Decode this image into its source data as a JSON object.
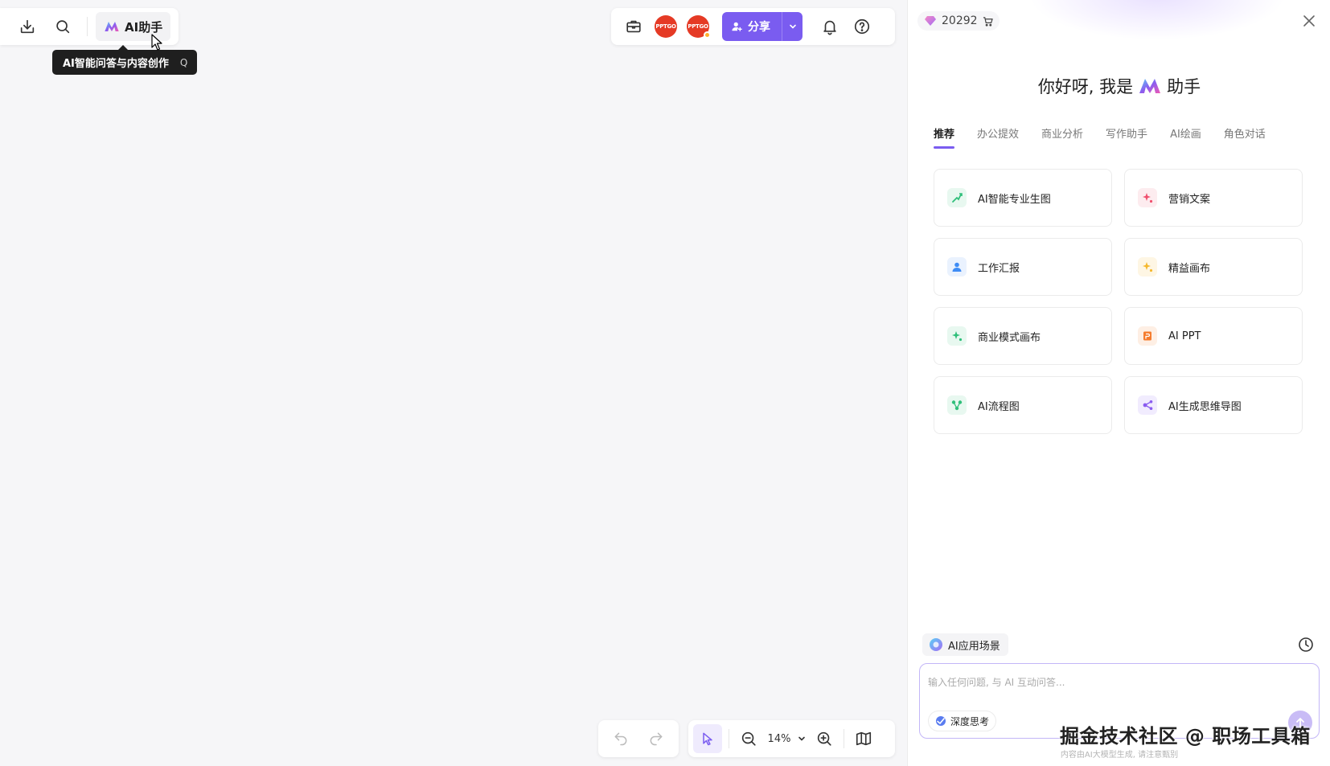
{
  "toolbar_left": {
    "ai_button_label": "AI助手",
    "tooltip_text": "AI智能问答与内容创作",
    "tooltip_shortcut": "Q"
  },
  "toolbar_right": {
    "avatar_text": "PPTGO",
    "share_label": "分享"
  },
  "zoom": {
    "value": "14%"
  },
  "panel": {
    "points": "20292",
    "greeting_prefix": "你好呀, 我是",
    "greeting_suffix": "助手",
    "tabs": [
      "推荐",
      "办公提效",
      "商业分析",
      "写作助手",
      "AI绘画",
      "角色对话"
    ],
    "active_tab": "推荐",
    "cards": [
      {
        "label": "AI智能专业生图",
        "icon": "image-gen-icon",
        "color": "#2fbf7a",
        "bg": "#e8f8f0"
      },
      {
        "label": "营销文案",
        "icon": "sparkle-icon",
        "color": "#f0506e",
        "bg": "#fdecef"
      },
      {
        "label": "工作汇报",
        "icon": "person-icon",
        "color": "#3e8cf5",
        "bg": "#eaf2fe"
      },
      {
        "label": "精益画布",
        "icon": "sparkle-icon",
        "color": "#f5b82e",
        "bg": "#fef6e4"
      },
      {
        "label": "商业模式画布",
        "icon": "sparkle-icon",
        "color": "#2fbf7a",
        "bg": "#e8f8f0"
      },
      {
        "label": "AI PPT",
        "icon": "ppt-icon",
        "color": "#f57c2e",
        "bg": "#feefe4"
      },
      {
        "label": "AI流程图",
        "icon": "flowchart-icon",
        "color": "#2fbf7a",
        "bg": "#e8f8f0"
      },
      {
        "label": "AI生成思维导图",
        "icon": "mindmap-icon",
        "color": "#8a5cf0",
        "bg": "#f1ecfe"
      }
    ],
    "scene_label": "AI应用场景",
    "input_placeholder": "输入任何问题, 与 AI 互动问答...",
    "deep_think_label": "深度思考",
    "disclaimer": "内容由AI大模型生成, 请注意甄别"
  },
  "watermark": "掘金技术社区 @ 职场工具箱",
  "colors": {
    "accent": "#7a5cf0",
    "avatar": "#e53a25"
  }
}
